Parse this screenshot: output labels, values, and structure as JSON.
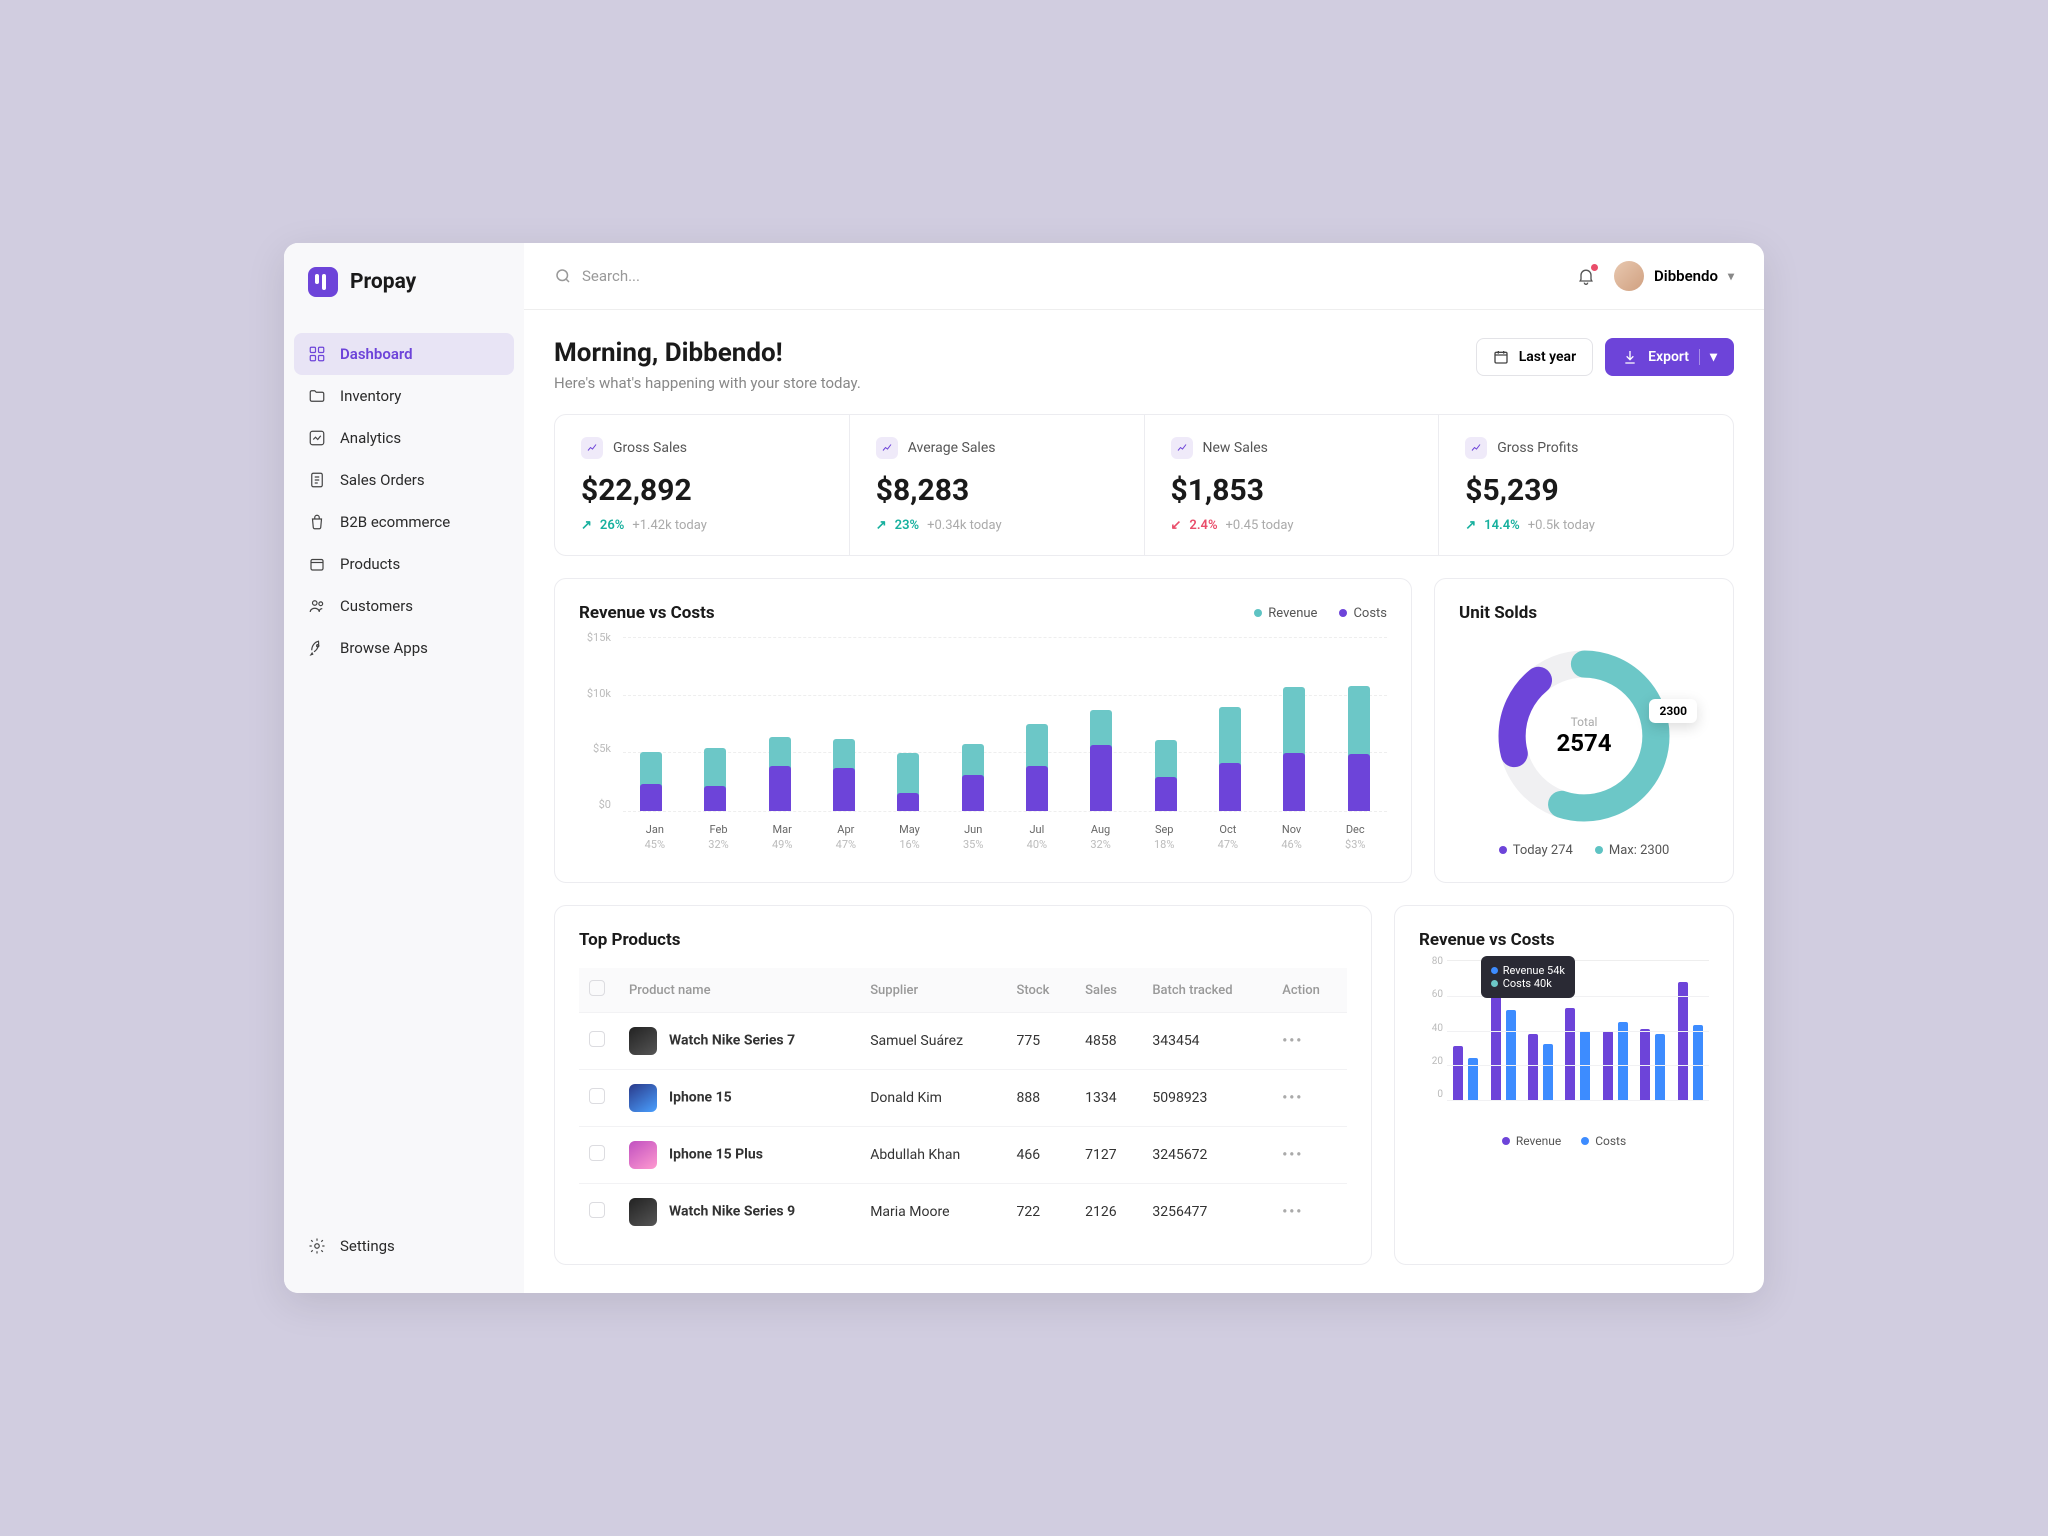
{
  "brand": "Propay",
  "search_placeholder": "Search...",
  "user_name": "Dibbendo",
  "sidebar": {
    "items": [
      {
        "label": "Dashboard"
      },
      {
        "label": "Inventory"
      },
      {
        "label": "Analytics"
      },
      {
        "label": "Sales Orders"
      },
      {
        "label": "B2B ecommerce"
      },
      {
        "label": "Products"
      },
      {
        "label": "Customers"
      },
      {
        "label": "Browse Apps"
      }
    ],
    "settings_label": "Settings"
  },
  "header": {
    "greeting": "Morning, Dibbendo!",
    "subtitle": "Here's what's happening with your store today.",
    "period_label": "Last year",
    "export_label": "Export"
  },
  "stats": [
    {
      "label": "Gross Sales",
      "value": "$22,892",
      "pct": "26%",
      "delta": "+1.42k today",
      "trend": "up"
    },
    {
      "label": "Average Sales",
      "value": "$8,283",
      "pct": "23%",
      "delta": "+0.34k today",
      "trend": "up"
    },
    {
      "label": "New Sales",
      "value": "$1,853",
      "pct": "2.4%",
      "delta": "+0.45 today",
      "trend": "down"
    },
    {
      "label": "Gross Profits",
      "value": "$5,239",
      "pct": "14.4%",
      "delta": "+0.5k today",
      "trend": "up"
    }
  ],
  "revenue_chart": {
    "title": "Revenue vs Costs",
    "legend": {
      "revenue": "Revenue",
      "costs": "Costs"
    },
    "y_ticks": [
      "$15k",
      "$10k",
      "$5k",
      "$0"
    ]
  },
  "chart_data": [
    {
      "id": "revenue_vs_costs_main",
      "type": "bar",
      "stacked": true,
      "title": "Revenue vs Costs",
      "ylabel": "$k",
      "ylim": [
        0,
        15
      ],
      "categories": [
        "Jan",
        "Feb",
        "Mar",
        "Apr",
        "May",
        "Jun",
        "Jul",
        "Aug",
        "Sep",
        "Oct",
        "Nov",
        "Dec"
      ],
      "percent_labels": [
        "45%",
        "32%",
        "49%",
        "47%",
        "16%",
        "35%",
        "40%",
        "32%",
        "18%",
        "47%",
        "46%",
        "$3%"
      ],
      "series": [
        {
          "name": "Costs",
          "color": "#6d44d9",
          "values": [
            2.4,
            2.2,
            4.0,
            3.8,
            1.6,
            3.2,
            4.0,
            5.8,
            3.0,
            4.2,
            5.1,
            5.0
          ]
        },
        {
          "name": "Revenue",
          "color": "#6cc7c7",
          "values": [
            3.1,
            3.6,
            2.8,
            2.8,
            3.8,
            3.0,
            3.9,
            3.4,
            3.5,
            5.2,
            6.1,
            6.3
          ]
        }
      ]
    },
    {
      "id": "unit_solds_donut",
      "type": "pie",
      "title": "Unit Solds",
      "total_label": "Total",
      "total_value": "2574",
      "badge": "2300",
      "series": [
        {
          "name": "Today",
          "value": 274,
          "color": "#6d44d9",
          "legend": "Today 274"
        },
        {
          "name": "Max",
          "value": 2300,
          "color": "#6cc7c7",
          "legend": "Max: 2300"
        }
      ]
    },
    {
      "id": "revenue_vs_costs_mini",
      "type": "bar",
      "title": "Revenue vs Costs",
      "ylim": [
        0,
        80
      ],
      "y_ticks": [
        80,
        60,
        40,
        20,
        0
      ],
      "tooltip": {
        "revenue": "Revenue 54k",
        "costs": "Costs 40k"
      },
      "legend": {
        "revenue": "Revenue",
        "costs": "Costs"
      },
      "series": [
        {
          "name": "Revenue",
          "color": "#6d44d9",
          "values": [
            31,
            60,
            38,
            53,
            40,
            41,
            68
          ]
        },
        {
          "name": "Costs",
          "color": "#3d8cff",
          "values": [
            24,
            52,
            32,
            40,
            45,
            38,
            43
          ]
        }
      ]
    }
  ],
  "unit_solds": {
    "title": "Unit Solds",
    "total_label": "Total",
    "total_value": "2574",
    "badge": "2300",
    "legend_today": "Today 274",
    "legend_max": "Max: 2300"
  },
  "products": {
    "title": "Top Products",
    "columns": [
      "Product name",
      "Supplier",
      "Stock",
      "Sales",
      "Batch tracked",
      "Action"
    ],
    "rows": [
      {
        "name": "Watch Nike Series 7",
        "supplier": "Samuel Suárez",
        "stock": "775",
        "sales": "4858",
        "batch": "343454",
        "img": "dark"
      },
      {
        "name": "Iphone 15",
        "supplier": "Donald Kim",
        "stock": "888",
        "sales": "1334",
        "batch": "5098923",
        "img": "blue"
      },
      {
        "name": "Iphone 15 Plus",
        "supplier": "Abdullah Khan",
        "stock": "466",
        "sales": "7127",
        "batch": "3245672",
        "img": "pink"
      },
      {
        "name": "Watch Nike Series 9",
        "supplier": "Maria Moore",
        "stock": "722",
        "sales": "2126",
        "batch": "3256477",
        "img": "dark"
      }
    ]
  },
  "mini_chart": {
    "title": "Revenue vs Costs",
    "tooltip_revenue": "Revenue 54k",
    "tooltip_costs": "Costs 40k",
    "legend_revenue": "Revenue",
    "legend_costs": "Costs"
  }
}
